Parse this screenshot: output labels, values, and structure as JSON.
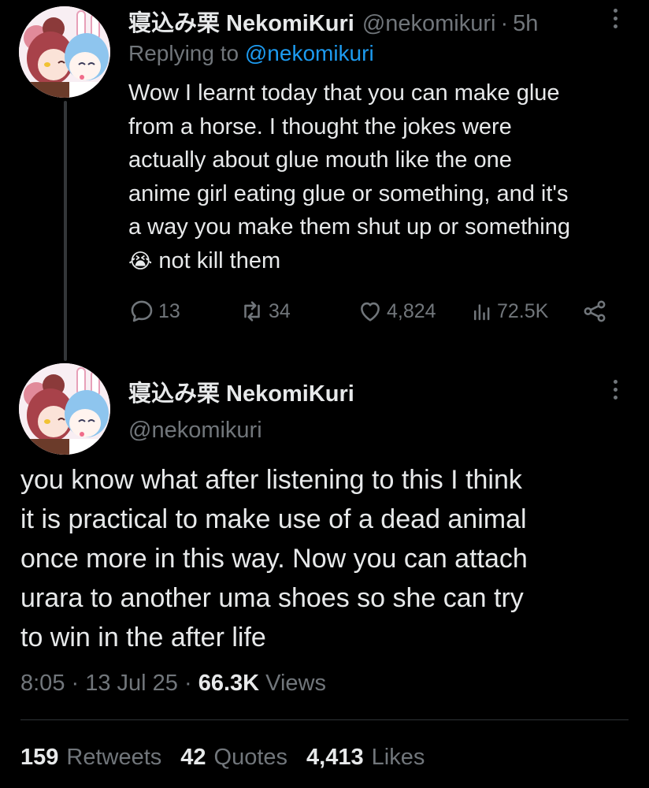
{
  "reply_tweet": {
    "display_name": "寝込み栗 NekomiKuri",
    "handle": "@nekomikuri",
    "time": "5h",
    "replying_prefix": "Replying to",
    "replying_handle": "@nekomikuri",
    "text_lines": [
      "Wow I learnt today that you can make glue",
      "from a horse. I thought the jokes were",
      "actually about glue mouth like the one",
      "anime girl eating glue or something, and it's",
      "a way you make them shut up or something"
    ],
    "last_line_emoji": "😭",
    "last_line_text": "not kill them",
    "actions": {
      "replies": "13",
      "retweets": "34",
      "likes": "4,824",
      "views": "72.5K"
    }
  },
  "main_tweet": {
    "display_name": "寝込み栗 NekomiKuri",
    "handle": "@nekomikuri",
    "text_lines": [
      "you know what after listening to this I think",
      "it is practical to make use of a dead animal",
      "once more in this way. Now you can attach",
      "urara to another uma shoes so she can try",
      "to win in the after life"
    ],
    "time": "8:05",
    "date": "13 Jul 25",
    "views_count": "66.3K",
    "views_label": "Views",
    "stats": {
      "retweets_count": "159",
      "retweets_label": "Retweets",
      "quotes_count": "42",
      "quotes_label": "Quotes",
      "likes_count": "4,413",
      "likes_label": "Likes"
    }
  },
  "colors": {
    "background": "#000000",
    "text": "#e7e9ea",
    "muted": "#71767b",
    "accent": "#1d9bf0"
  },
  "icons": [
    "reply-icon",
    "retweet-icon",
    "like-icon",
    "views-icon",
    "share-icon",
    "more-icon"
  ]
}
